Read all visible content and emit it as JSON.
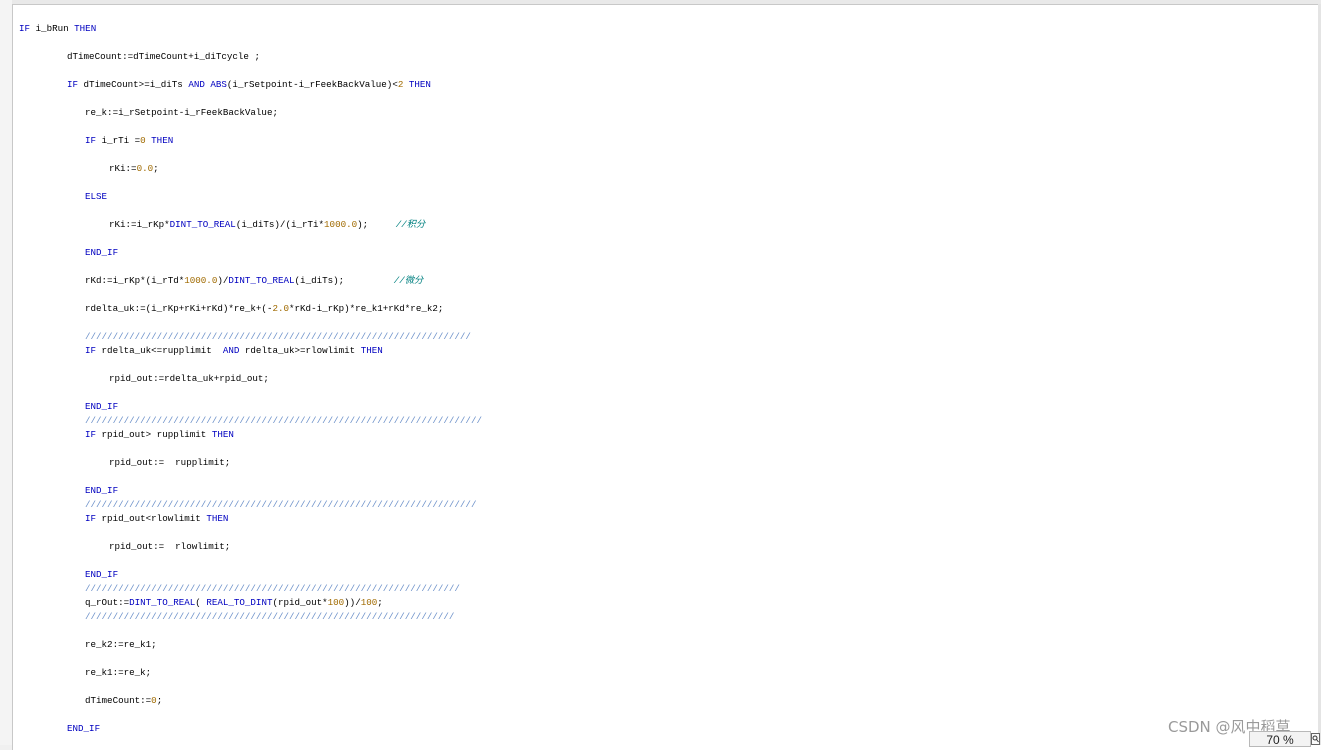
{
  "code": {
    "lines": [
      {
        "indent": 0,
        "tokens": [
          [
            "kw",
            "IF"
          ],
          [
            "",
            "i_bRun"
          ],
          [
            "kw",
            "THEN"
          ]
        ],
        "sep": " "
      },
      {
        "indent": 1,
        "tokens": [
          [
            "",
            "dTimeCount:=dTimeCount+i_diTcycle ;"
          ]
        ],
        "sep": ""
      },
      {
        "indent": 1,
        "tokens": [
          [
            "kw",
            "IF"
          ],
          [
            "",
            " dTimeCount>=i_diTs "
          ],
          [
            "kw",
            "AND"
          ],
          [
            "",
            " "
          ],
          [
            "kw",
            "ABS"
          ],
          [
            "",
            "(i_rSetpoint-i_rFeekBackValue)<"
          ],
          [
            "num",
            "2"
          ],
          [
            "",
            " "
          ],
          [
            "kw",
            "THEN"
          ]
        ],
        "sep": ""
      },
      {
        "indent": 2,
        "tokens": [
          [
            "",
            "re_k:=i_rSetpoint-i_rFeekBackValue;"
          ]
        ],
        "sep": ""
      },
      {
        "indent": 2,
        "tokens": [
          [
            "kw",
            "IF"
          ],
          [
            "",
            " i_rTi ="
          ],
          [
            "num",
            "0"
          ],
          [
            "",
            " "
          ],
          [
            "kw",
            "THEN"
          ]
        ],
        "sep": ""
      },
      {
        "indent": 3,
        "tokens": [
          [
            "",
            "rKi:="
          ],
          [
            "num",
            "0.0"
          ],
          [
            "",
            ";"
          ]
        ],
        "sep": ""
      },
      {
        "indent": 2,
        "tokens": [
          [
            "kw",
            "ELSE"
          ]
        ],
        "sep": ""
      },
      {
        "indent": 3,
        "tokens": [
          [
            "",
            "rKi:=i_rKp*"
          ],
          [
            "kw",
            "DINT_TO_REAL"
          ],
          [
            "",
            "(i_diTs)/(i_rTi*"
          ],
          [
            "num",
            "1000.0"
          ],
          [
            "",
            ");     "
          ],
          [
            "cm",
            "//积分"
          ]
        ],
        "sep": ""
      },
      {
        "indent": 2,
        "tokens": [
          [
            "kw",
            "END_IF"
          ]
        ],
        "sep": ""
      },
      {
        "indent": 2,
        "tokens": [
          [
            "",
            "rKd:=i_rKp*(i_rTd*"
          ],
          [
            "num",
            "1000.0"
          ],
          [
            "",
            ")/"
          ],
          [
            "kw",
            "DINT_TO_REAL"
          ],
          [
            "",
            "(i_diTs);         "
          ],
          [
            "cm",
            "//微分"
          ]
        ],
        "sep": ""
      },
      {
        "indent": 2,
        "tokens": [
          [
            "",
            "rdelta_uk:=(i_rKp+rKi+rKd)*re_k+(-"
          ],
          [
            "num",
            "2.0"
          ],
          [
            "",
            "*rKd-i_rKp)*re_k1+rKd*re_k2;"
          ]
        ],
        "sep": ""
      },
      {
        "indent": 2,
        "tokens": [
          [
            "sep",
            "//////////////////////////////////////////////////////////////////////"
          ]
        ],
        "sep": ""
      },
      {
        "indent": 2,
        "tokens": [
          [
            "kw",
            "IF"
          ],
          [
            "",
            " rdelta_uk<=rupplimit  "
          ],
          [
            "kw",
            "AND"
          ],
          [
            "",
            " rdelta_uk>=rlowlimit "
          ],
          [
            "kw",
            "THEN"
          ]
        ],
        "sep": ""
      },
      {
        "indent": 3,
        "tokens": [
          [
            "",
            "rpid_out:=rdelta_uk+rpid_out;"
          ]
        ],
        "sep": ""
      },
      {
        "indent": 2,
        "tokens": [
          [
            "kw",
            "END_IF"
          ]
        ],
        "sep": ""
      },
      {
        "indent": 2,
        "tokens": [
          [
            "sep",
            "////////////////////////////////////////////////////////////////////////"
          ]
        ],
        "sep": ""
      },
      {
        "indent": 2,
        "tokens": [
          [
            "kw",
            "IF"
          ],
          [
            "",
            " rpid_out> rupplimit "
          ],
          [
            "kw",
            "THEN"
          ]
        ],
        "sep": ""
      },
      {
        "indent": 3,
        "tokens": [
          [
            "",
            "rpid_out:=  rupplimit;"
          ]
        ],
        "sep": ""
      },
      {
        "indent": 2,
        "tokens": [
          [
            "kw",
            "END_IF"
          ]
        ],
        "sep": ""
      },
      {
        "indent": 2,
        "tokens": [
          [
            "sep",
            "///////////////////////////////////////////////////////////////////////"
          ]
        ],
        "sep": ""
      },
      {
        "indent": 2,
        "tokens": [
          [
            "kw",
            "IF"
          ],
          [
            "",
            " rpid_out<rlowlimit "
          ],
          [
            "kw",
            "THEN"
          ]
        ],
        "sep": ""
      },
      {
        "indent": 3,
        "tokens": [
          [
            "",
            "rpid_out:=  rlowlimit;"
          ]
        ],
        "sep": ""
      },
      {
        "indent": 2,
        "tokens": [
          [
            "kw",
            "END_IF"
          ]
        ],
        "sep": ""
      },
      {
        "indent": 2,
        "tokens": [
          [
            "sep",
            "////////////////////////////////////////////////////////////////////"
          ]
        ],
        "sep": ""
      },
      {
        "indent": 2,
        "tokens": [
          [
            "",
            "q_rOut:="
          ],
          [
            "kw",
            "DINT_TO_REAL"
          ],
          [
            "",
            "( "
          ],
          [
            "kw",
            "REAL_TO_DINT"
          ],
          [
            "",
            "(rpid_out*"
          ],
          [
            "num",
            "100"
          ],
          [
            "",
            "))/"
          ],
          [
            "num",
            "100"
          ],
          [
            "",
            ";"
          ]
        ],
        "sep": ""
      },
      {
        "indent": 2,
        "tokens": [
          [
            "sep",
            "///////////////////////////////////////////////////////////////////"
          ]
        ],
        "sep": ""
      },
      {
        "indent": 2,
        "tokens": [
          [
            "",
            "re_k2:=re_k1;"
          ]
        ],
        "sep": ""
      },
      {
        "indent": 2,
        "tokens": [
          [
            "",
            "re_k1:=re_k;"
          ]
        ],
        "sep": ""
      },
      {
        "indent": 2,
        "tokens": [
          [
            "",
            "dTimeCount:="
          ],
          [
            "num",
            "0"
          ],
          [
            "",
            ";"
          ]
        ],
        "sep": ""
      },
      {
        "indent": 1,
        "tokens": [
          [
            "kw",
            "END_IF"
          ]
        ],
        "sep": ""
      }
    ]
  },
  "statusbar": {
    "zoom": "70 %"
  },
  "watermark": "CSDN @风中稻草",
  "icons": {
    "splitter": "splitter-handle-icon",
    "zoom": "zoom-lens-icon"
  }
}
